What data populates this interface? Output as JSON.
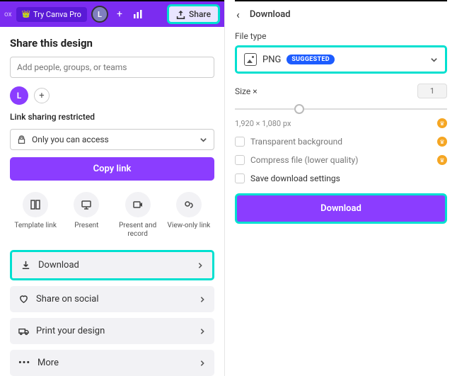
{
  "topbar": {
    "brand_suffix": "ox",
    "try_pro": "Try Canva Pro",
    "avatar_letter": "L",
    "share_label": "Share"
  },
  "share_panel": {
    "title": "Share this design",
    "input_placeholder": "Add people, groups, or teams",
    "avatar_letter": "L",
    "link_restricted": "Link sharing restricted",
    "access_label": "Only you can access",
    "copy_link": "Copy link",
    "quick_actions": [
      {
        "icon": "template-link-icon",
        "label": "Template link"
      },
      {
        "icon": "present-icon",
        "label": "Present"
      },
      {
        "icon": "present-record-icon",
        "label": "Present and record"
      },
      {
        "icon": "view-only-icon",
        "label": "View-only link"
      }
    ],
    "list": [
      {
        "icon": "download-icon",
        "label": "Download",
        "highlight": true
      },
      {
        "icon": "heart-icon",
        "label": "Share on social",
        "highlight": false
      },
      {
        "icon": "truck-icon",
        "label": "Print your design",
        "highlight": false
      },
      {
        "icon": "more-icon",
        "label": "More",
        "highlight": false
      }
    ]
  },
  "download_panel": {
    "title": "Download",
    "file_type_label": "File type",
    "file_type_value": "PNG",
    "suggested_pill": "SUGGESTED",
    "size_label": "Size ×",
    "size_value": "1",
    "dimensions": "1,920 × 1,080 px",
    "options": [
      {
        "label": "Transparent background",
        "pro": true
      },
      {
        "label": "Compress file (lower quality)",
        "pro": true
      },
      {
        "label": "Save download settings",
        "pro": false
      }
    ],
    "download_button": "Download"
  }
}
